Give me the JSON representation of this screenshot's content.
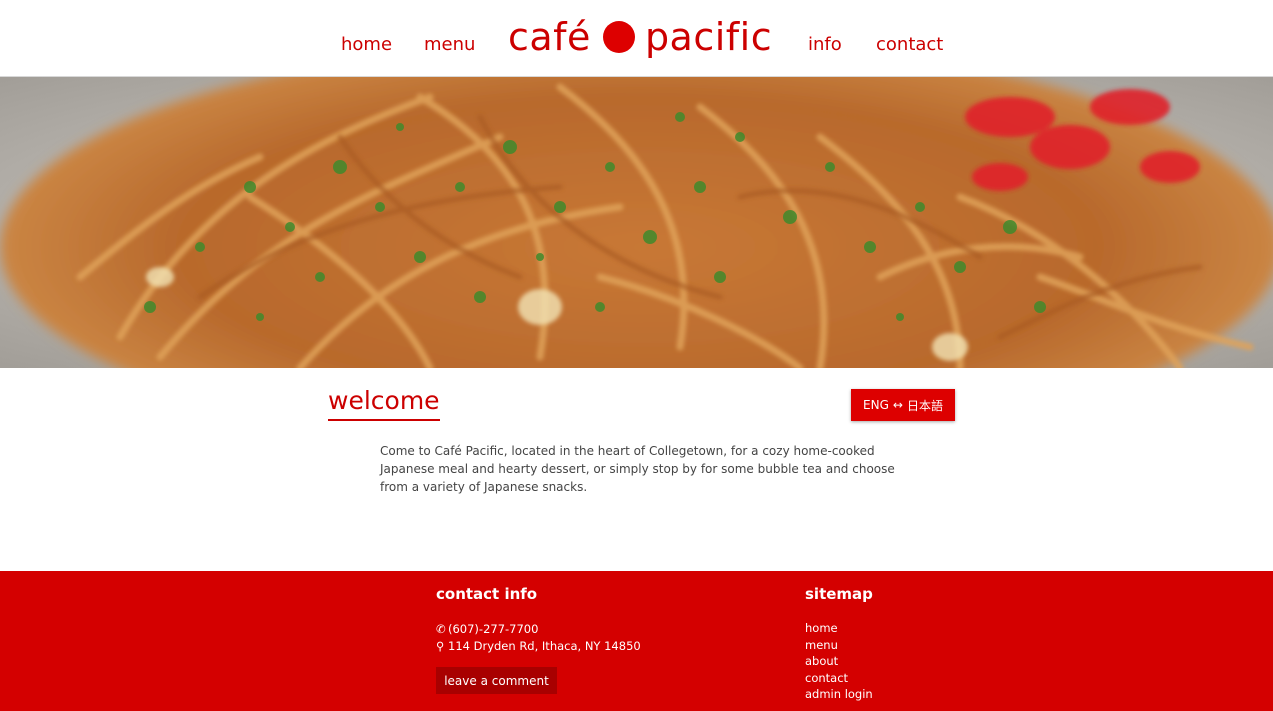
{
  "nav": {
    "home": "home",
    "menu": "menu",
    "info": "info",
    "contact": "contact"
  },
  "logo": {
    "left_text": "café",
    "right_text": "pacific"
  },
  "hero": {
    "image": "yakisoba-noodles-photo"
  },
  "welcome": {
    "title": "welcome",
    "language_toggle": {
      "left": "ENG",
      "arrow": "↔",
      "right": "日本語"
    },
    "text": "Come to Café Pacific, located in the heart of Collegetown, for a cozy home-cooked Japanese meal and hearty dessert, or simply stop by for some bubble tea and choose from a variety of Japanese snacks."
  },
  "footer": {
    "contact_heading": "contact info",
    "phone": "(607)-277-7700",
    "address": "114 Dryden Rd, Ithaca, NY 14850",
    "comment_button": "leave a comment",
    "sitemap_heading": "sitemap",
    "sitemap": [
      "home",
      "menu",
      "about",
      "contact",
      "admin login"
    ]
  },
  "colors": {
    "brand": "#cc0000",
    "footer_bg": "#d40000",
    "button_dark": "#a80000"
  }
}
